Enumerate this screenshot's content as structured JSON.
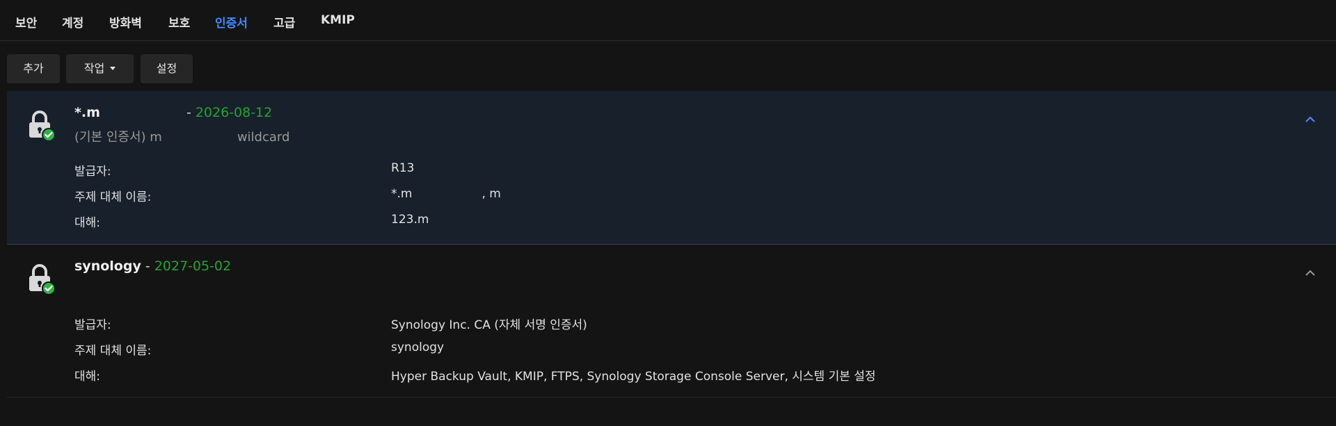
{
  "tabs": [
    {
      "label": "보안"
    },
    {
      "label": "계정"
    },
    {
      "label": "방화벽"
    },
    {
      "label": "보호"
    },
    {
      "label": "인증서",
      "active": true
    },
    {
      "label": "고급"
    },
    {
      "label": "KMIP"
    }
  ],
  "toolbar": {
    "add_label": "추가",
    "action_label": "작업",
    "settings_label": "설정"
  },
  "labels": {
    "issuer": "발급자:",
    "san": "주제 대체 이름:",
    "used_for": "대해:"
  },
  "certificates": [
    {
      "name": "*.m",
      "dash": "-",
      "expiry": "2026-08-12",
      "subtitle_prefix": "(기본 인증서) m",
      "subtitle_suffix": "wildcard",
      "issuer": "R13",
      "san_part1": "*.m",
      "san_part2": ", m",
      "used_for": "123.m",
      "selected": true
    },
    {
      "name": "synology",
      "dash": "-",
      "expiry": "2027-05-02",
      "issuer": "Synology Inc. CA (자체 서명 인증서)",
      "san": "synology",
      "used_for": "Hyper Backup Vault, KMIP, FTPS, Synology Storage Console Server, 시스템 기본 설정",
      "selected": false
    }
  ],
  "colors": {
    "accent": "#3d8bfd",
    "expiry_green": "#22a52e",
    "selected_bg": "#17202b",
    "badge_green": "#2fb344"
  },
  "icons": {
    "lock": "lock-check-icon",
    "expand": "chevron-up-icon"
  }
}
